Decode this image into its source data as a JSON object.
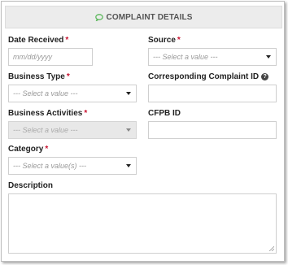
{
  "section": {
    "title": "COMPLAINT DETAILS",
    "icon": "speech-bubble-icon"
  },
  "fields": {
    "date_received": {
      "label": "Date Received",
      "required": "*",
      "placeholder": "mm/dd/yyyy"
    },
    "source": {
      "label": "Source",
      "required": "*",
      "value": "--- Select a value ---"
    },
    "business_type": {
      "label": "Business Type",
      "required": "*",
      "value": "--- Select a value ---"
    },
    "corresponding_complaint_id": {
      "label": "Corresponding Complaint ID",
      "help_icon": "question-circle-icon",
      "help_glyph": "?"
    },
    "business_activities": {
      "label": "Business Activities",
      "required": "*",
      "value": "--- Select a value ---"
    },
    "cfpb_id": {
      "label": "CFPB ID"
    },
    "category": {
      "label": "Category",
      "required": "*",
      "value": "--- Select a value(s) ---"
    },
    "description": {
      "label": "Description"
    }
  },
  "colors": {
    "required": "#c8102e",
    "header_icon": "#5cb85c"
  }
}
